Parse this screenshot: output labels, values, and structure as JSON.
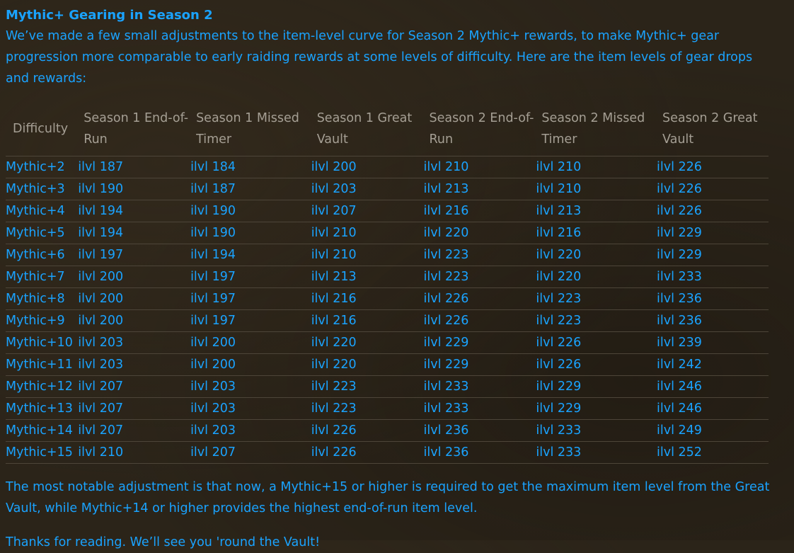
{
  "article": {
    "heading": "Mythic+ Gearing in Season 2",
    "intro": "We’ve made a few small adjustments to the item-level curve for Season 2 Mythic+ rewards, to make Mythic+ gear progression more comparable to early raiding rewards at some levels of difficulty. Here are the item levels of gear drops and rewards:",
    "outro": "The most notable adjustment is that now, a Mythic+15 or higher is required to get the maximum item level from the Great Vault, while Mythic+14 or higher provides the highest end-of-run item level.",
    "thanks": "Thanks for reading. We’ll see you 'round the Vault!"
  },
  "table": {
    "headers": [
      "Difficulty",
      "Season 1 End-of-Run",
      "Season 1 Missed Timer",
      "Season 1 Great Vault",
      "Season 2 End-of-Run",
      "Season 2 Missed Timer",
      "Season 2 Great Vault"
    ],
    "rows": [
      [
        "Mythic+2",
        "ilvl 187",
        "ilvl 184",
        "ilvl 200",
        "ilvl 210",
        "ilvl 210",
        "ilvl 226"
      ],
      [
        "Mythic+3",
        "ilvl 190",
        "ilvl 187",
        "ilvl 203",
        "ilvl 213",
        "ilvl 210",
        "ilvl 226"
      ],
      [
        "Mythic+4",
        "ilvl 194",
        "ilvl 190",
        "ilvl 207",
        "ilvl 216",
        "ilvl 213",
        "ilvl 226"
      ],
      [
        "Mythic+5",
        "ilvl 194",
        "ilvl 190",
        "ilvl 210",
        "ilvl 220",
        "ilvl 216",
        "ilvl 229"
      ],
      [
        "Mythic+6",
        "ilvl 197",
        "ilvl 194",
        "ilvl 210",
        "ilvl 223",
        "ilvl 220",
        "ilvl 229"
      ],
      [
        "Mythic+7",
        "ilvl 200",
        "ilvl 197",
        "ilvl 213",
        "ilvl 223",
        "ilvl 220",
        "ilvl 233"
      ],
      [
        "Mythic+8",
        "ilvl 200",
        "ilvl 197",
        "ilvl 216",
        "ilvl 226",
        "ilvl 223",
        "ilvl 236"
      ],
      [
        "Mythic+9",
        "ilvl 200",
        "ilvl 197",
        "ilvl 216",
        "ilvl 226",
        "ilvl 223",
        "ilvl 236"
      ],
      [
        "Mythic+10",
        "ilvl 203",
        "ilvl 200",
        "ilvl 220",
        "ilvl 229",
        "ilvl 226",
        "ilvl 239"
      ],
      [
        "Mythic+11",
        "ilvl 203",
        "ilvl 200",
        "ilvl 220",
        "ilvl 229",
        "ilvl 226",
        "ilvl 242"
      ],
      [
        "Mythic+12",
        "ilvl 207",
        "ilvl 203",
        "ilvl 223",
        "ilvl 233",
        "ilvl 229",
        "ilvl 246"
      ],
      [
        "Mythic+13",
        "ilvl 207",
        "ilvl 203",
        "ilvl 223",
        "ilvl 233",
        "ilvl 229",
        "ilvl 246"
      ],
      [
        "Mythic+14",
        "ilvl 207",
        "ilvl 203",
        "ilvl 226",
        "ilvl 236",
        "ilvl 233",
        "ilvl 249"
      ],
      [
        "Mythic+15",
        "ilvl 210",
        "ilvl 207",
        "ilvl 226",
        "ilvl 236",
        "ilvl 233",
        "ilvl 252"
      ]
    ]
  }
}
